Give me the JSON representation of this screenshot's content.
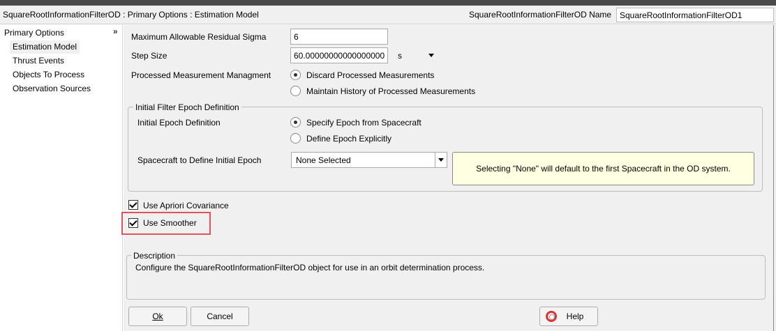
{
  "header": {
    "title": "SquareRootInformationFilterOD : Primary Options : Estimation Model",
    "name_label": "SquareRootInformationFilterOD Name",
    "name_value": "SquareRootInformationFilterOD1"
  },
  "sidebar": {
    "heading": "Primary Options",
    "collapse_glyph": "»",
    "items": [
      {
        "label": "Estimation Model",
        "selected": true
      },
      {
        "label": "Thrust Events"
      },
      {
        "label": "Objects To Process"
      },
      {
        "label": "Observation Sources"
      }
    ]
  },
  "form": {
    "max_residual_label": "Maximum Allowable Residual Sigma",
    "max_residual_value": "6",
    "step_size_label": "Step Size",
    "step_size_value": "60.00000000000000000",
    "step_unit": "s",
    "processed_label": "Processed Measurement Managment",
    "processed_options": [
      {
        "label": "Discard Processed Measurements",
        "selected": true
      },
      {
        "label": "Maintain History of Processed Measurements",
        "selected": false
      }
    ]
  },
  "epoch_group": {
    "legend": "Initial Filter Epoch Definition",
    "definition_label": "Initial Epoch Definition",
    "options": [
      {
        "label": "Specify Epoch from Spacecraft",
        "selected": true
      },
      {
        "label": "Define Epoch Explicitly",
        "selected": false
      }
    ],
    "spacecraft_label": "Spacecraft to Define Initial Epoch",
    "spacecraft_value": "None Selected",
    "note": "Selecting \"None\" will default to the first Spacecraft in the OD system."
  },
  "checks": {
    "apriori_label": "Use Apriori Covariance",
    "apriori_checked": true,
    "smoother_label": "Use Smoother",
    "smoother_checked": true
  },
  "description": {
    "legend": "Description",
    "text": "Configure the SquareRootInformationFilterOD object for use in an orbit determination process."
  },
  "buttons": {
    "ok": "Ok",
    "cancel": "Cancel",
    "help": "Help"
  },
  "colors": {
    "highlight": "#e0535a",
    "note_bg": "#ffffe1"
  }
}
